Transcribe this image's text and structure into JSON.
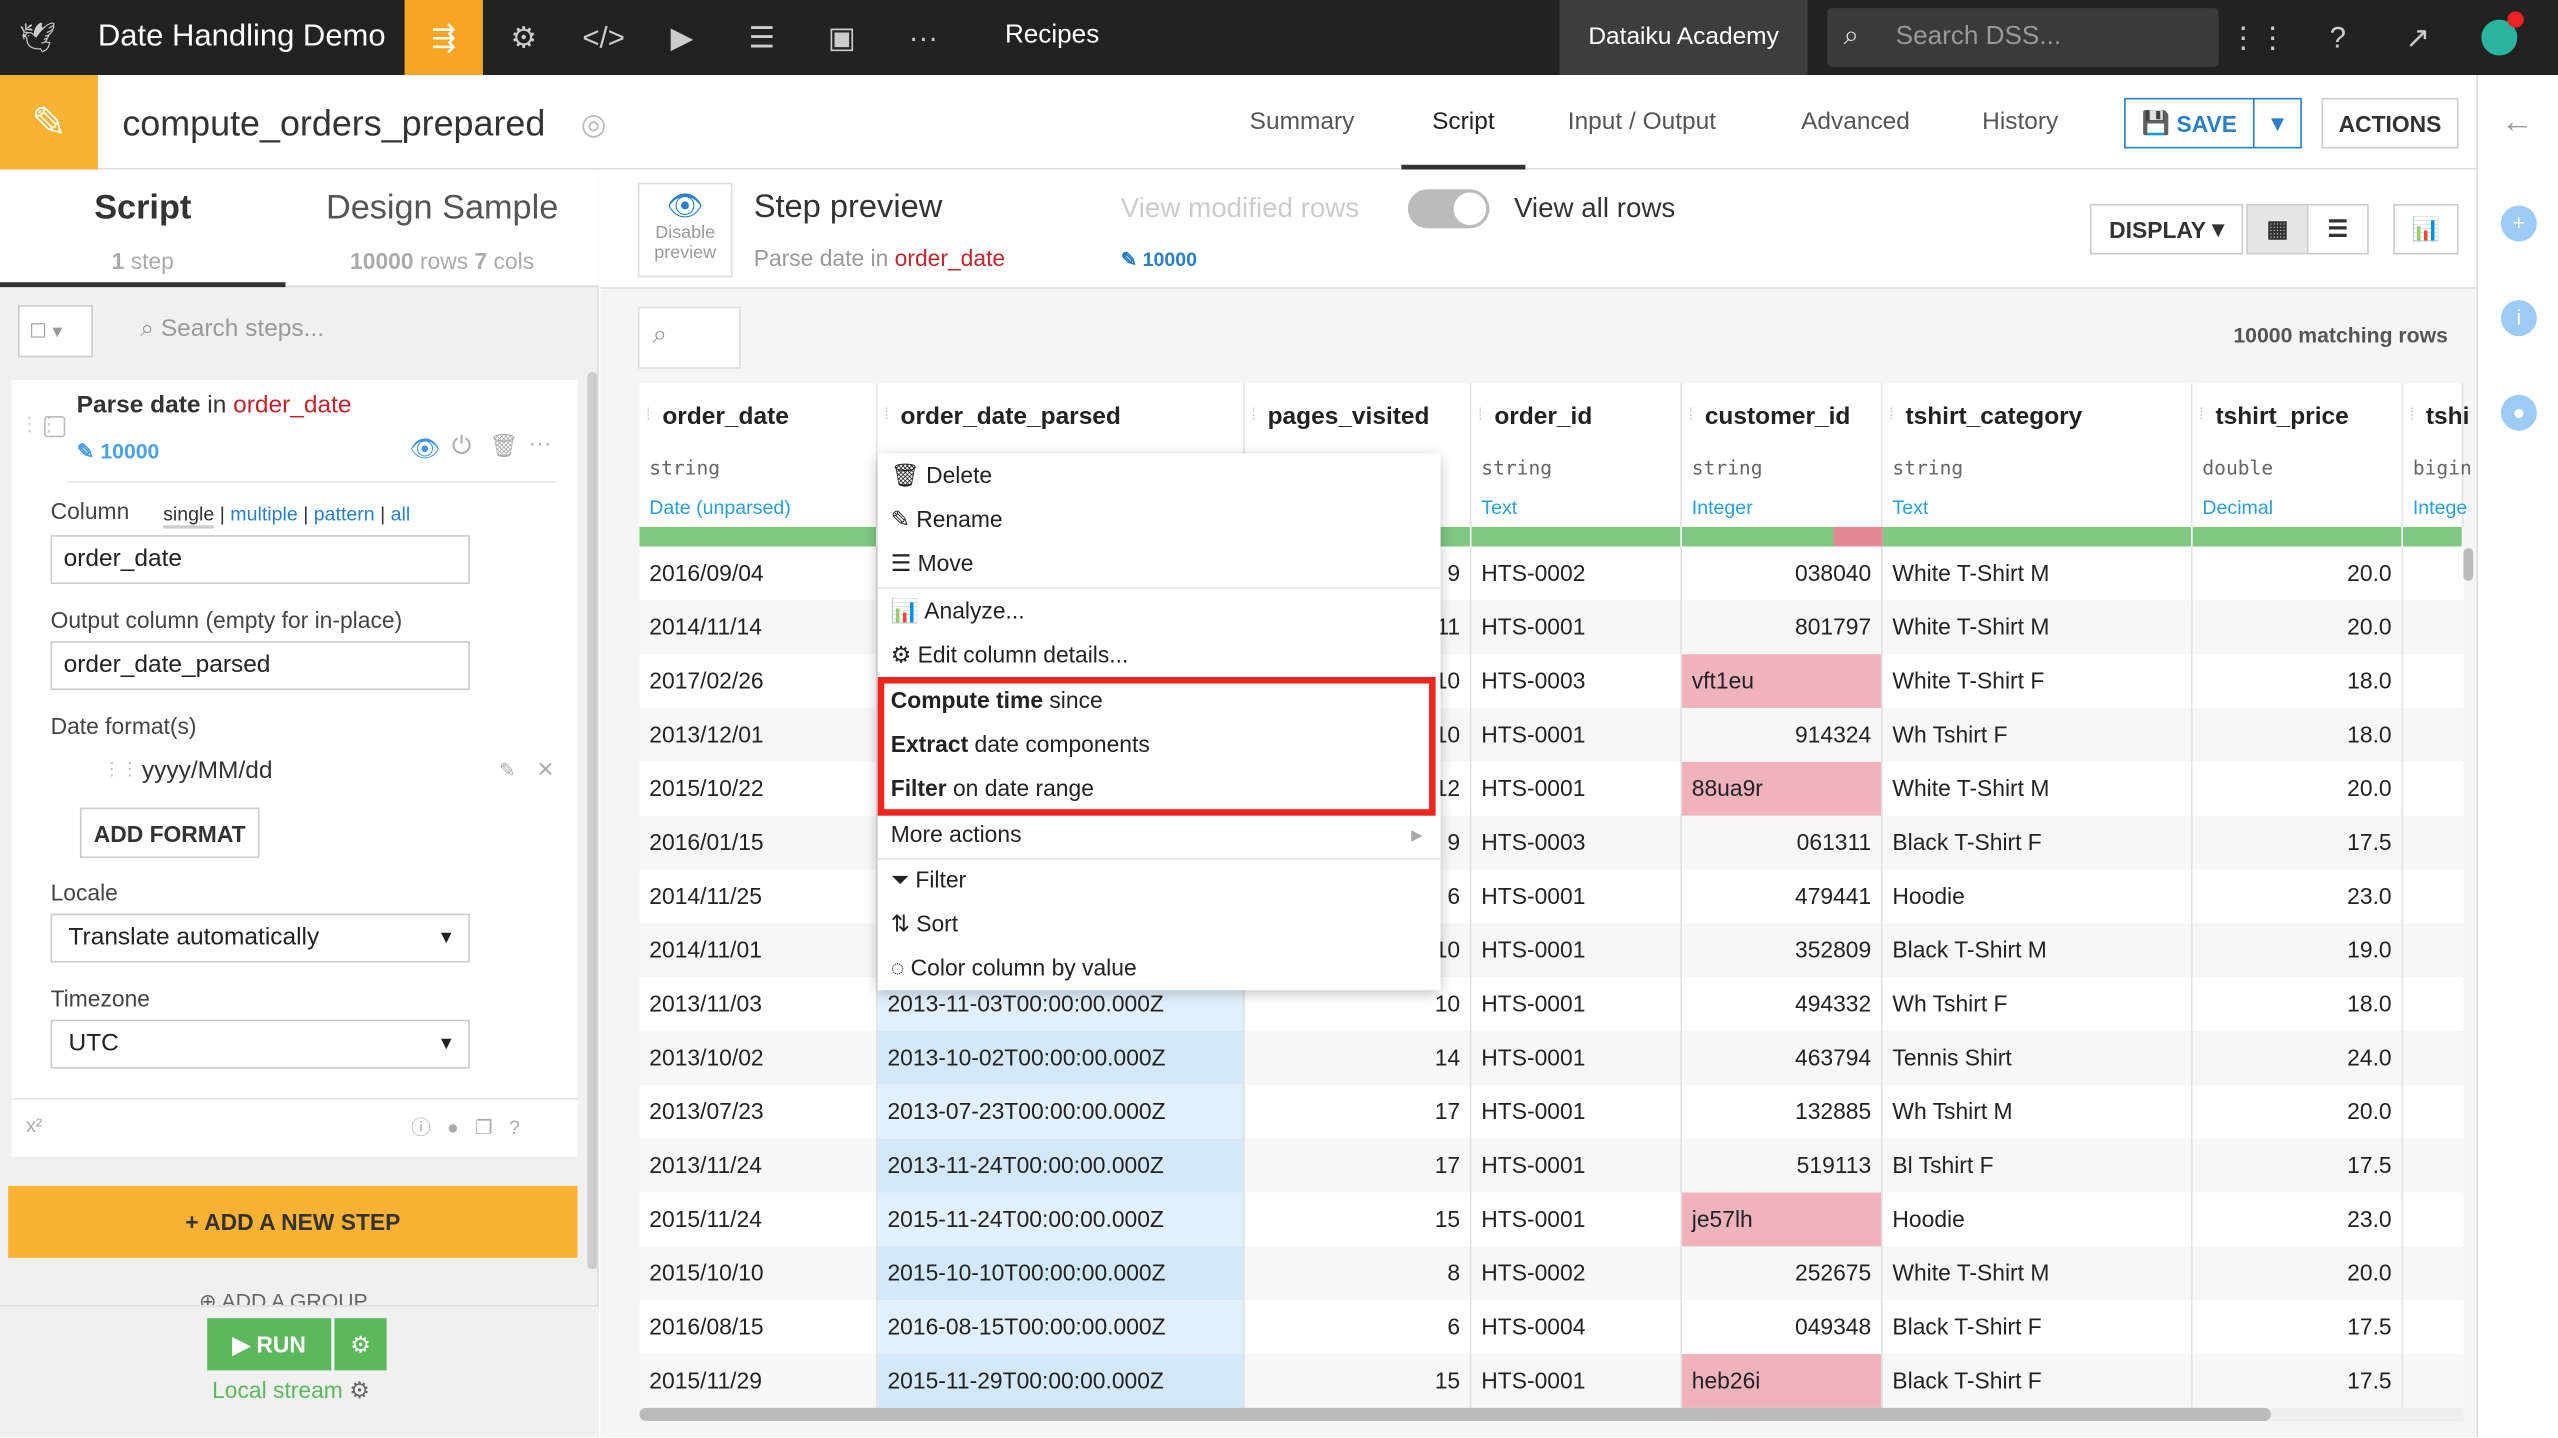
{
  "topbar": {
    "project": "Date Handling Demo",
    "section": "Recipes",
    "academy": "Dataiku Academy",
    "search_placeholder": "Search DSS...",
    "accent": "#f5a623"
  },
  "recipe": {
    "name": "compute_orders_prepared",
    "tabs": [
      "Summary",
      "Script",
      "Input / Output",
      "Advanced",
      "History"
    ],
    "active_tab": "Script",
    "save": "SAVE",
    "actions": "ACTIONS"
  },
  "left": {
    "tab_script": "Script",
    "tab_design": "Design Sample",
    "script_sub_n": "1",
    "script_sub": "step",
    "design_rows": "10000",
    "design_rows_lbl": "rows",
    "design_cols": "7",
    "design_cols_lbl": "cols",
    "search_placeholder": "Search steps...",
    "step": {
      "title": "Parse date",
      "in": "in",
      "column": "order_date",
      "count": "10000",
      "column_label": "Column",
      "modes": [
        "single",
        "multiple",
        "pattern",
        "all"
      ],
      "column_value": "order_date",
      "output_label": "Output column (empty for in-place)",
      "output_value": "order_date_parsed",
      "formats_label": "Date format(s)",
      "format": "yyyy/MM/dd",
      "add_format": "ADD FORMAT",
      "locale_label": "Locale",
      "locale": "Translate automatically",
      "tz_label": "Timezone",
      "tz": "UTC",
      "xsup": "x²"
    },
    "add_step": "+ ADD A NEW STEP",
    "add_group": "ADD A GROUP",
    "run": "RUN",
    "stream": "Local stream"
  },
  "preview": {
    "disable": "Disable preview",
    "title": "Step preview",
    "sub_a": "Parse date in",
    "sub_col": "order_date",
    "modified": "View modified rows",
    "all": "View all rows",
    "count": "10000",
    "display": "DISPLAY",
    "matching": "10000 matching rows"
  },
  "columns": [
    {
      "name": "order_date",
      "type": "string",
      "meaning": "Date (unparsed)"
    },
    {
      "name": "order_date_parsed",
      "type": "",
      "meaning": ""
    },
    {
      "name": "pages_visited",
      "type": "",
      "meaning": ""
    },
    {
      "name": "order_id",
      "type": "string",
      "meaning": "Text"
    },
    {
      "name": "customer_id",
      "type": "string",
      "meaning": "Integer"
    },
    {
      "name": "tshirt_category",
      "type": "string",
      "meaning": "Text"
    },
    {
      "name": "tshirt_price",
      "type": "double",
      "meaning": "Decimal"
    },
    {
      "name": "tshi",
      "type": "bigin",
      "meaning": "Intege"
    }
  ],
  "rows": [
    [
      "2016/09/04",
      "",
      "9",
      "HTS-0002",
      "038040",
      "White T-Shirt M",
      "20.0"
    ],
    [
      "2014/11/14",
      "",
      "11",
      "HTS-0001",
      "801797",
      "White T-Shirt M",
      "20.0"
    ],
    [
      "2017/02/26",
      "",
      "10",
      "HTS-0003",
      "vft1eu",
      "White T-Shirt F",
      "18.0"
    ],
    [
      "2013/12/01",
      "",
      "10",
      "HTS-0001",
      "914324",
      "Wh Tshirt F",
      "18.0"
    ],
    [
      "2015/10/22",
      "",
      "12",
      "HTS-0001",
      "88ua9r",
      "White T-Shirt M",
      "20.0"
    ],
    [
      "2016/01/15",
      "",
      "9",
      "HTS-0003",
      "061311",
      "Black T-Shirt F",
      "17.5"
    ],
    [
      "2014/11/25",
      "",
      "6",
      "HTS-0001",
      "479441",
      "Hoodie",
      "23.0"
    ],
    [
      "2014/11/01",
      "",
      "10",
      "HTS-0001",
      "352809",
      "Black T-Shirt M",
      "19.0"
    ],
    [
      "2013/11/03",
      "2013-11-03T00:00:00.000Z",
      "10",
      "HTS-0001",
      "494332",
      "Wh Tshirt F",
      "18.0"
    ],
    [
      "2013/10/02",
      "2013-10-02T00:00:00.000Z",
      "14",
      "HTS-0001",
      "463794",
      "Tennis Shirt",
      "24.0"
    ],
    [
      "2013/07/23",
      "2013-07-23T00:00:00.000Z",
      "17",
      "HTS-0001",
      "132885",
      "Wh Tshirt M",
      "20.0"
    ],
    [
      "2013/11/24",
      "2013-11-24T00:00:00.000Z",
      "17",
      "HTS-0001",
      "519113",
      "Bl Tshirt F",
      "17.5"
    ],
    [
      "2015/11/24",
      "2015-11-24T00:00:00.000Z",
      "15",
      "HTS-0001",
      "je57lh",
      "Hoodie",
      "23.0"
    ],
    [
      "2015/10/10",
      "2015-10-10T00:00:00.000Z",
      "8",
      "HTS-0002",
      "252675",
      "White T-Shirt M",
      "20.0"
    ],
    [
      "2016/08/15",
      "2016-08-15T00:00:00.000Z",
      "6",
      "HTS-0004",
      "049348",
      "Black T-Shirt F",
      "17.5"
    ],
    [
      "2015/11/29",
      "2015-11-29T00:00:00.000Z",
      "15",
      "HTS-0001",
      "heb26i",
      "Black T-Shirt F",
      "17.5"
    ]
  ],
  "invalid_cells": [
    "vft1eu",
    "88ua9r",
    "je57lh",
    "heb26i"
  ],
  "menu": {
    "delete": "Delete",
    "rename": "Rename",
    "move": "Move",
    "analyze": "Analyze...",
    "edit": "Edit column details...",
    "compute_b": "Compute time",
    "compute": "since",
    "extract_b": "Extract",
    "extract": "date components",
    "filter_b": "Filter",
    "filter": "on date range",
    "more": "More actions",
    "filter2": "Filter",
    "sort": "Sort",
    "color": "Color column by value"
  }
}
